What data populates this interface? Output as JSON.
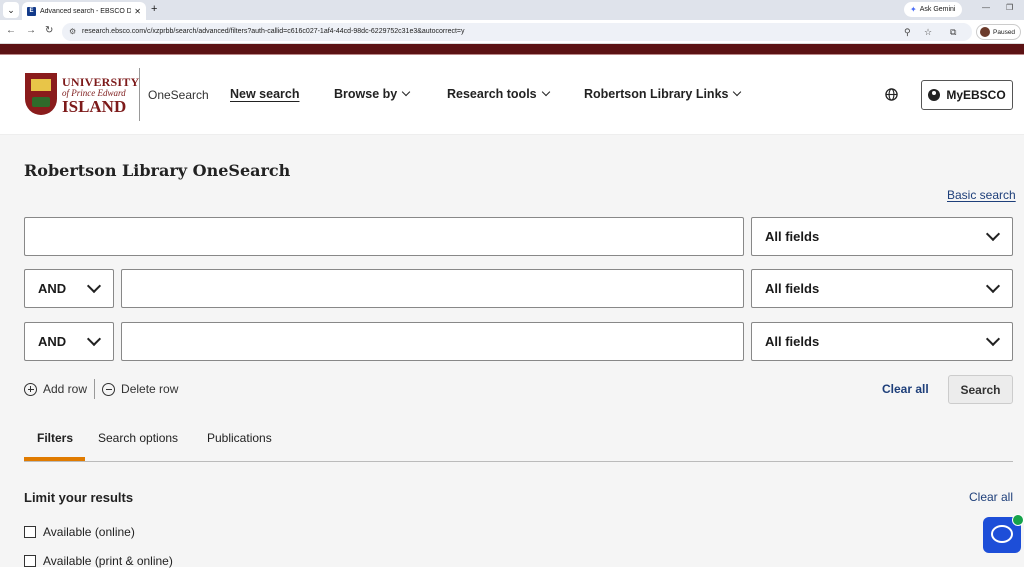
{
  "browser": {
    "tab_title": "Advanced search - EBSCO Disc",
    "favicon_letter": "E",
    "url": "research.ebsco.com/c/xzprbb/search/advanced/filters?auth-callid=c616c027-1af4-44cd-98dc-6229752c31e3&autocorrect=y",
    "gemini_label": "Ask Gemini",
    "profile_status": "Paused"
  },
  "header": {
    "logo": {
      "line1": "UNIVERSITY",
      "line2": "of Prince Edward",
      "line3": "ISLAND"
    },
    "product": "OneSearch",
    "nav": [
      {
        "label": "New search"
      },
      {
        "label": "Browse by"
      },
      {
        "label": "Research tools"
      },
      {
        "label": "Robertson Library Links"
      }
    ],
    "account_label": "MyEBSCO"
  },
  "main": {
    "title": "Robertson Library OneSearch",
    "basic_search_link": "Basic search",
    "rows": [
      {
        "operator": "",
        "value": "",
        "field": "All fields"
      },
      {
        "operator": "AND",
        "value": "",
        "field": "All fields"
      },
      {
        "operator": "AND",
        "value": "",
        "field": "All fields"
      }
    ],
    "add_row": "Add row",
    "delete_row": "Delete row",
    "clear_all": "Clear all",
    "search_button": "Search",
    "tabs": [
      "Filters",
      "Search options",
      "Publications"
    ],
    "active_tab": "Filters",
    "limit_heading": "Limit your results",
    "limit_clear_all": "Clear all",
    "limits": [
      "Available (online)",
      "Available (print & online)"
    ]
  },
  "colors": {
    "accent": "#e07b00",
    "link": "#1e3f7a",
    "brand": "#7d1a1a",
    "chat": "#1d4ed8"
  }
}
